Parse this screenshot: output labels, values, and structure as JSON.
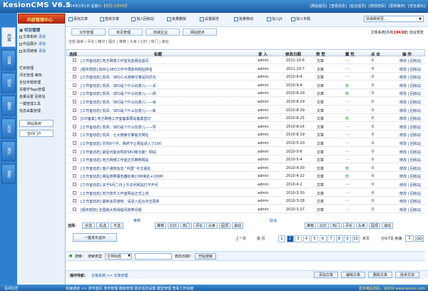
{
  "app": {
    "logo": "KesionCMS V6.5",
    "date_prefix": "2014年2月1日 星期六【",
    "date_link": "农历:1月2日",
    "date_suffix": "】",
    "top_links": [
      "[网站首页]",
      "[查看信息]",
      "[后台首页]",
      "[修改密码]",
      "[更新缓存]",
      "[安全退出]"
    ]
  },
  "left_tabs": [
    "内容",
    "设置",
    "相关",
    "模型",
    "论坛",
    "用户",
    "插件"
  ],
  "menu": {
    "header": "内容管理中心",
    "group1": "栏目管理",
    "items1": [
      {
        "label": "文章系统",
        "plus": "添加"
      },
      {
        "label": "作品展示",
        "plus": "添加"
      },
      {
        "label": "友情链接",
        "plus": "添加"
      }
    ],
    "items2": [
      "栏目管理",
      "评论管理 审核",
      "全站专题管理",
      "关键字Tags管理",
      "批量设置 回收站",
      "一键管理工具",
      "信息采集管理"
    ],
    "buttons": [
      "网站系统",
      "空间门户"
    ]
  },
  "toolbar": {
    "items": [
      "添加文章",
      "签收文章",
      "加入回收站",
      "批量删除",
      "设置属性",
      "批量移动",
      "加入JS",
      "加入专题"
    ],
    "quick_select": "快速跳转至..."
  },
  "subtabs": [
    "文件管理",
    "单页管理",
    "商城企业",
    "网站技术"
  ],
  "stats": {
    "prefix": "文章系统[共有",
    "count": "1963",
    "suffix": "篇]  前台预览"
  },
  "breadcrumb": "全部  最新 | 评论 | 精华 | 图片 | 推荐 | 头条 | 幻灯 | 热门 | 滚动",
  "table": {
    "headers": [
      "选择",
      "标题",
      "录 入",
      "修改日期",
      "类 型",
      "属 性",
      "点 击",
      "操 作"
    ],
    "rows": [
      {
        "title": "[工作室动态] 地方网络工作室完善网站首页",
        "author": "admin",
        "date": "2011-10-6",
        "type": "文章",
        "attr": "---",
        "hits": "0",
        "ops": "修改 | 回收站"
      },
      {
        "title": "[服务帮助] 如何让SEO工作不再影响网站排名",
        "author": "admin",
        "date": "2011-10-7",
        "type": "文章",
        "attr": "---",
        "hits": "0",
        "ops": "修改 | 回收站"
      },
      {
        "title": "[工作室动态] 凯风：SEO三大搜索引擎站内优化",
        "author": "admin",
        "date": "2010-9-4",
        "type": "文章",
        "attr": "---",
        "hits": "0",
        "ops": "修改 | 回收站"
      },
      {
        "title": "[工作室动态] 凯风：SEO是个什么玩意儿——关",
        "author": "admin",
        "date": "2010-9-4",
        "type": "文章",
        "attr": "荐",
        "hits": "0",
        "ops": "修改 | 回收站"
      },
      {
        "title": "[工作室动态] 凯风：SEO是个什么玩意儿——网",
        "author": "admin",
        "date": "2010-8-29",
        "type": "文章",
        "attr": "荐",
        "hits": "0",
        "ops": "修改 | 回收站"
      },
      {
        "title": "[工作室动态] 凯风：SEO是个什么玩意儿——目",
        "author": "admin",
        "date": "2010-8-29",
        "type": "文章",
        "attr": "---",
        "hits": "0",
        "ops": "修改 | 回收站"
      },
      {
        "title": "[工作室动态] 凯风：SEO是个什么玩意儿——新",
        "author": "admin",
        "date": "2010-8-29",
        "type": "文章",
        "attr": "---",
        "hits": "0",
        "ops": "修改 | 回收站"
      },
      {
        "title": "[ICP备案] 地方网络工作室备案网站备案登记",
        "author": "admin",
        "date": "2010-8-25",
        "type": "文章",
        "attr": "荐",
        "hits": "0",
        "ops": "修改 | 回收站"
      },
      {
        "title": "[工作室动态] 凯风：SEO是个什么玩意儿——导",
        "author": "admin",
        "date": "2010-8-24",
        "type": "文章",
        "attr": "---",
        "hits": "0",
        "ops": "修改 | 回收站"
      },
      {
        "title": "[工作室动态] 凯风：七大搜索引擎提交网址",
        "author": "admin",
        "date": "2010-8-19",
        "type": "文章",
        "attr": "---",
        "hits": "0",
        "ops": "修改 | 回收站"
      },
      {
        "title": "[工作室动态] 历时9个月，我终于让网站进入了100",
        "author": "admin",
        "date": "2010-5-20",
        "type": "文章",
        "attr": "---",
        "hits": "0",
        "ops": "修改 | 回收站"
      },
      {
        "title": "[工作室动态] 最后可能出现的SEO新功能！网站",
        "author": "admin",
        "date": "2010-5-6",
        "type": "文章",
        "attr": "---",
        "hits": "0",
        "ops": "修改 | 回收站"
      },
      {
        "title": "[工作室动态] 地方网络工作室正式推荐网站",
        "author": "admin",
        "date": "2010-5-4",
        "type": "文章",
        "attr": "---",
        "hits": "0",
        "ops": "修改 | 回收站"
      },
      {
        "title": "[工作室动态] 客户通知信息 \"中国\" 中文域名",
        "author": "admin",
        "date": "2010-4-30",
        "type": "文章",
        "attr": "荐",
        "hits": "0",
        "ops": "修改 | 回收站"
      },
      {
        "title": "[工作室动态] 网站按照服务器标准COM域名+100M",
        "author": "admin",
        "date": "2010-4-22",
        "type": "文章",
        "attr": "荐",
        "hits": "0",
        "ops": "修改 | 回收站"
      },
      {
        "title": "[工作室动态] 关于6月二日上午访问网站打不开问",
        "author": "admin",
        "date": "2010-4-2",
        "type": "文章",
        "attr": "---",
        "hits": "0",
        "ops": "修改 | 回收站"
      },
      {
        "title": "[工作室动态] 地方软件工作室网站正式上线",
        "author": "admin",
        "date": "2010-3-30",
        "type": "文章",
        "attr": "---",
        "hits": "0",
        "ops": "修改 | 回收站"
      },
      {
        "title": "[工作室动态] 最新会员通知：请进入后台点击更新",
        "author": "admin",
        "date": "2010-3-28",
        "type": "文章",
        "attr": "---",
        "hits": "0",
        "ops": "修改 | 回收站"
      },
      {
        "title": "[服务帮助] 全国最大现场提问搞笑问题",
        "author": "admin",
        "date": "2010-3-27",
        "type": "文章",
        "attr": "---",
        "hits": "0",
        "ops": "修改 | 回收站"
      }
    ]
  },
  "selection": {
    "label": "选择：",
    "buttons": [
      "全选",
      "反选",
      "不选"
    ],
    "recommend_label": "推荐",
    "cancel_label": "取消",
    "attr_buttons": [
      "推荐",
      "幻灯",
      "热门",
      "评论",
      "头条",
      "固顶",
      "滚动"
    ],
    "attr_buttons2": [
      "推荐",
      "幻灯",
      "热门",
      "评论",
      "头条",
      "固顶",
      "滚动"
    ],
    "action_button": "一键发布选中"
  },
  "pager": {
    "prev": "上一页",
    "first": "首 页",
    "pages": [
      "1",
      "2",
      "3",
      "4",
      "5",
      "6",
      "7",
      "8",
      "9",
      "10"
    ],
    "last": "末页",
    "info": "分0/7页 到第",
    "page_input": "2",
    "go": "GO"
  },
  "search": {
    "label": "搜索：",
    "type_label": "搜索类型",
    "type_value": "文档标题",
    "date_label": "修改日期?",
    "button": "开始搜索"
  },
  "bottom": {
    "nav_label": "操作导航：",
    "nav_path": "文章系统 >> 文章管理",
    "buttons": [
      "添加文章",
      "编辑文章",
      "删除文章",
      "技术交流"
    ]
  },
  "statusbar": {
    "left": "关闭左栏",
    "links": "快速通道 >>  发布首页  发布管理  模板管理  基本信息设置  模型管理  查看工作进度",
    "right": "更多精品源码，请访问 www.kesion.com"
  }
}
